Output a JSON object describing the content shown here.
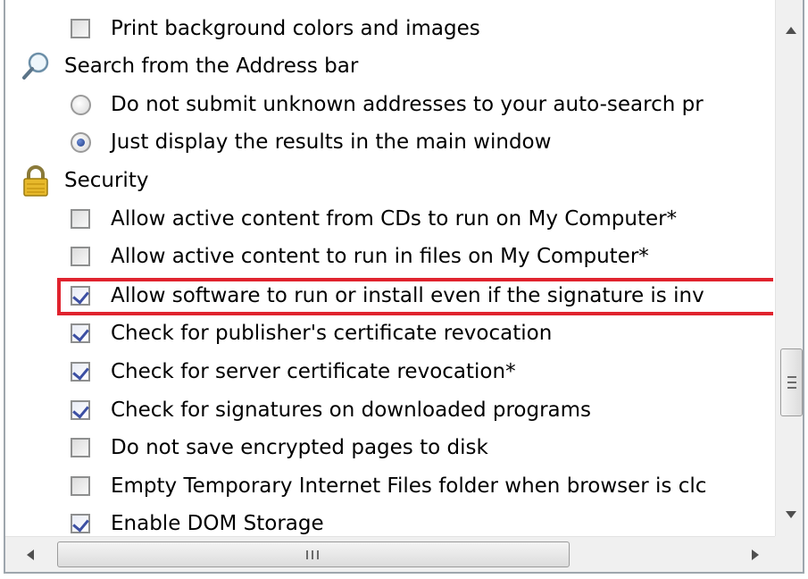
{
  "settings": {
    "items": [
      {
        "kind": "checkbox",
        "checked": false,
        "label": "Print background colors and images"
      },
      {
        "kind": "header",
        "icon": "magnifier-icon",
        "label": "Search from the Address bar"
      },
      {
        "kind": "radio",
        "selected": false,
        "label": "Do not submit unknown addresses to your auto-search pr"
      },
      {
        "kind": "radio",
        "selected": true,
        "label": "Just display the results in the main window"
      },
      {
        "kind": "header",
        "icon": "padlock-icon",
        "label": "Security"
      },
      {
        "kind": "checkbox",
        "checked": false,
        "label": "Allow active content from CDs to run on My Computer*"
      },
      {
        "kind": "checkbox",
        "checked": false,
        "label": "Allow active content to run in files on My Computer*"
      },
      {
        "kind": "checkbox",
        "checked": true,
        "highlighted": true,
        "label": "Allow software to run or install even if the signature is inv"
      },
      {
        "kind": "checkbox",
        "checked": true,
        "label": "Check for publisher's certificate revocation"
      },
      {
        "kind": "checkbox",
        "checked": true,
        "label": "Check for server certificate revocation*"
      },
      {
        "kind": "checkbox",
        "checked": true,
        "label": "Check for signatures on downloaded programs"
      },
      {
        "kind": "checkbox",
        "checked": false,
        "label": "Do not save encrypted pages to disk"
      },
      {
        "kind": "checkbox",
        "checked": false,
        "label": "Empty Temporary Internet Files folder when browser is clc"
      },
      {
        "kind": "checkbox",
        "checked": true,
        "label": "Enable DOM Storage"
      }
    ]
  },
  "colors": {
    "highlight": "#e0232e",
    "check": "#3c4fa3"
  }
}
